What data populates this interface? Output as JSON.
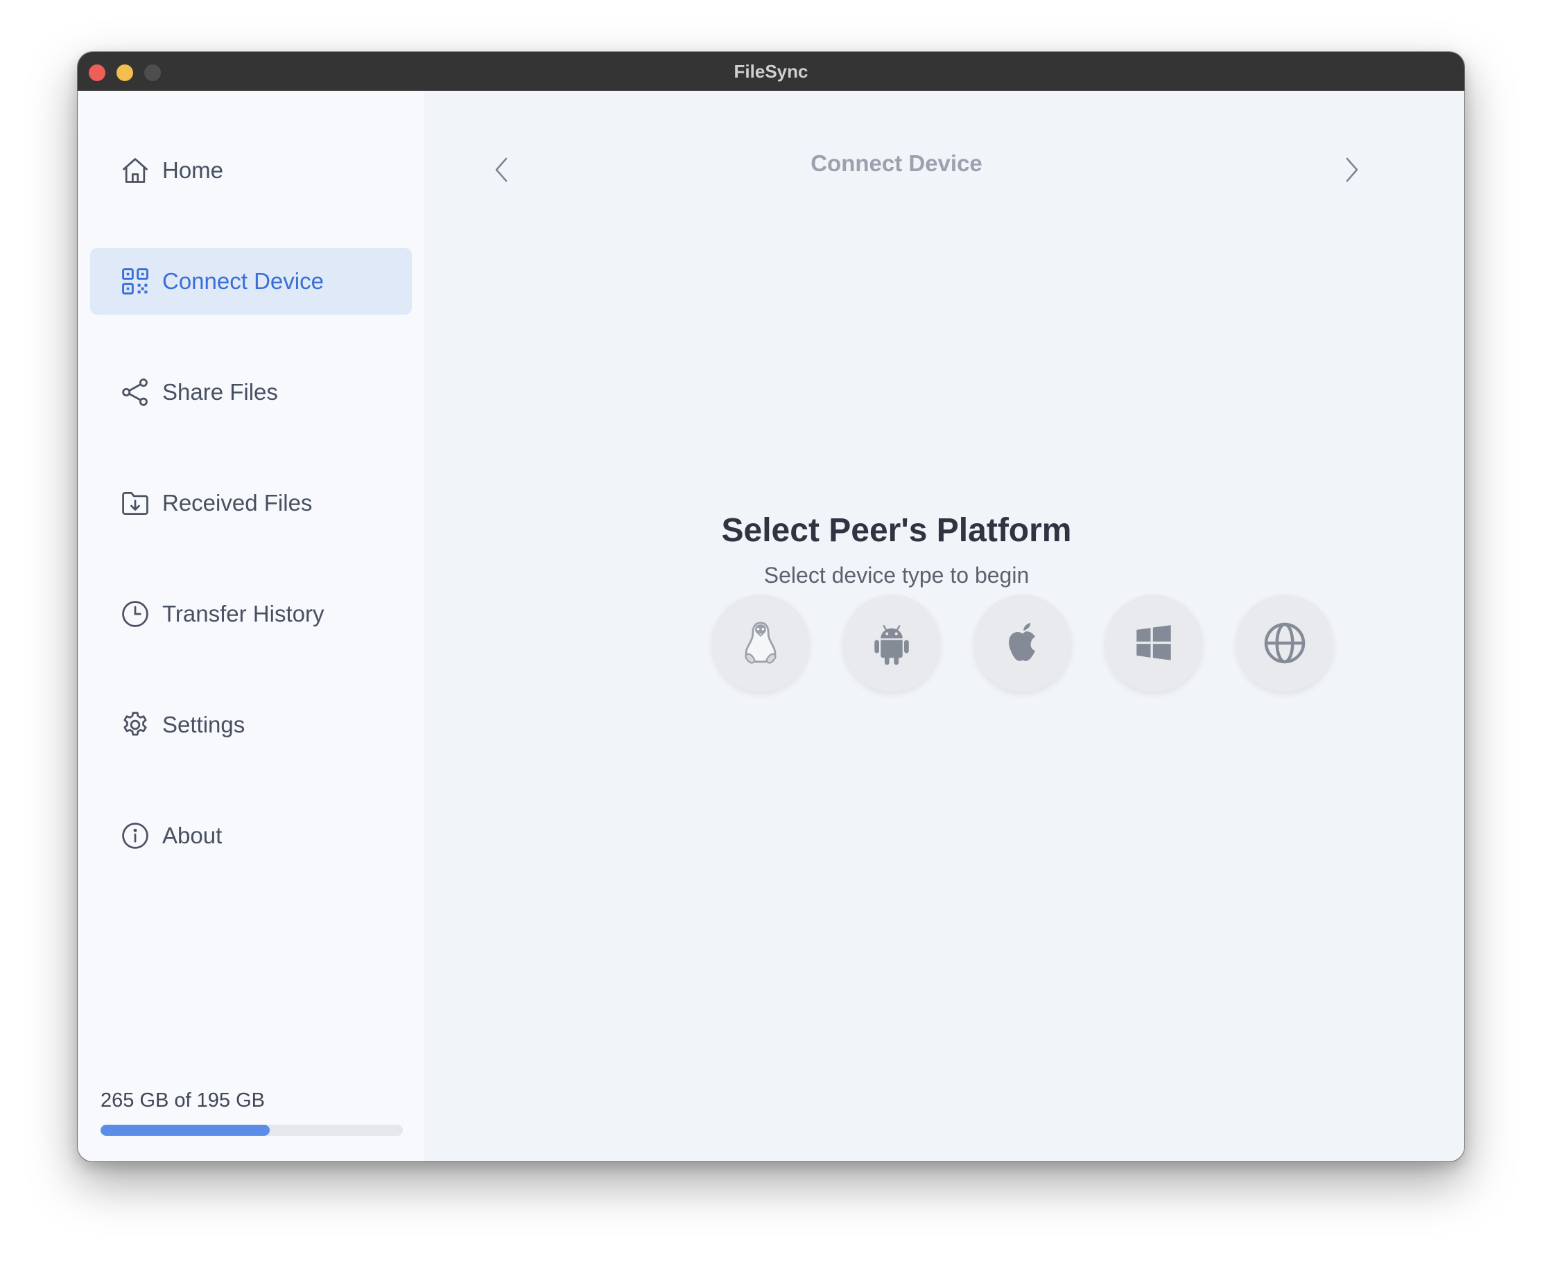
{
  "window": {
    "title": "FileSync"
  },
  "sidebar": {
    "items": [
      {
        "label": "Home",
        "icon": "home-icon"
      },
      {
        "label": "Connect Device",
        "icon": "qr-code-icon",
        "active": true
      },
      {
        "label": "Share Files",
        "icon": "share-icon"
      },
      {
        "label": "Received Files",
        "icon": "folder-download-icon"
      },
      {
        "label": "Transfer History",
        "icon": "clock-icon"
      },
      {
        "label": "Settings",
        "icon": "gear-icon"
      },
      {
        "label": "About",
        "icon": "info-icon"
      }
    ],
    "storage": {
      "text": "265 GB of 195 GB",
      "fill_fraction": 0.56,
      "fill_color": "#5b8ce6"
    }
  },
  "main": {
    "header_title": "Connect Device",
    "heading": "Select Peer's Platform",
    "subheading": "Select device type to begin",
    "platforms": [
      {
        "icon": "linux-icon"
      },
      {
        "icon": "android-icon"
      },
      {
        "icon": "apple-icon"
      },
      {
        "icon": "windows-icon"
      },
      {
        "icon": "globe-icon"
      }
    ]
  },
  "colors": {
    "accent": "#3a6fd8",
    "active_bg": "#dfe9f8",
    "titlebar": "#343434"
  }
}
